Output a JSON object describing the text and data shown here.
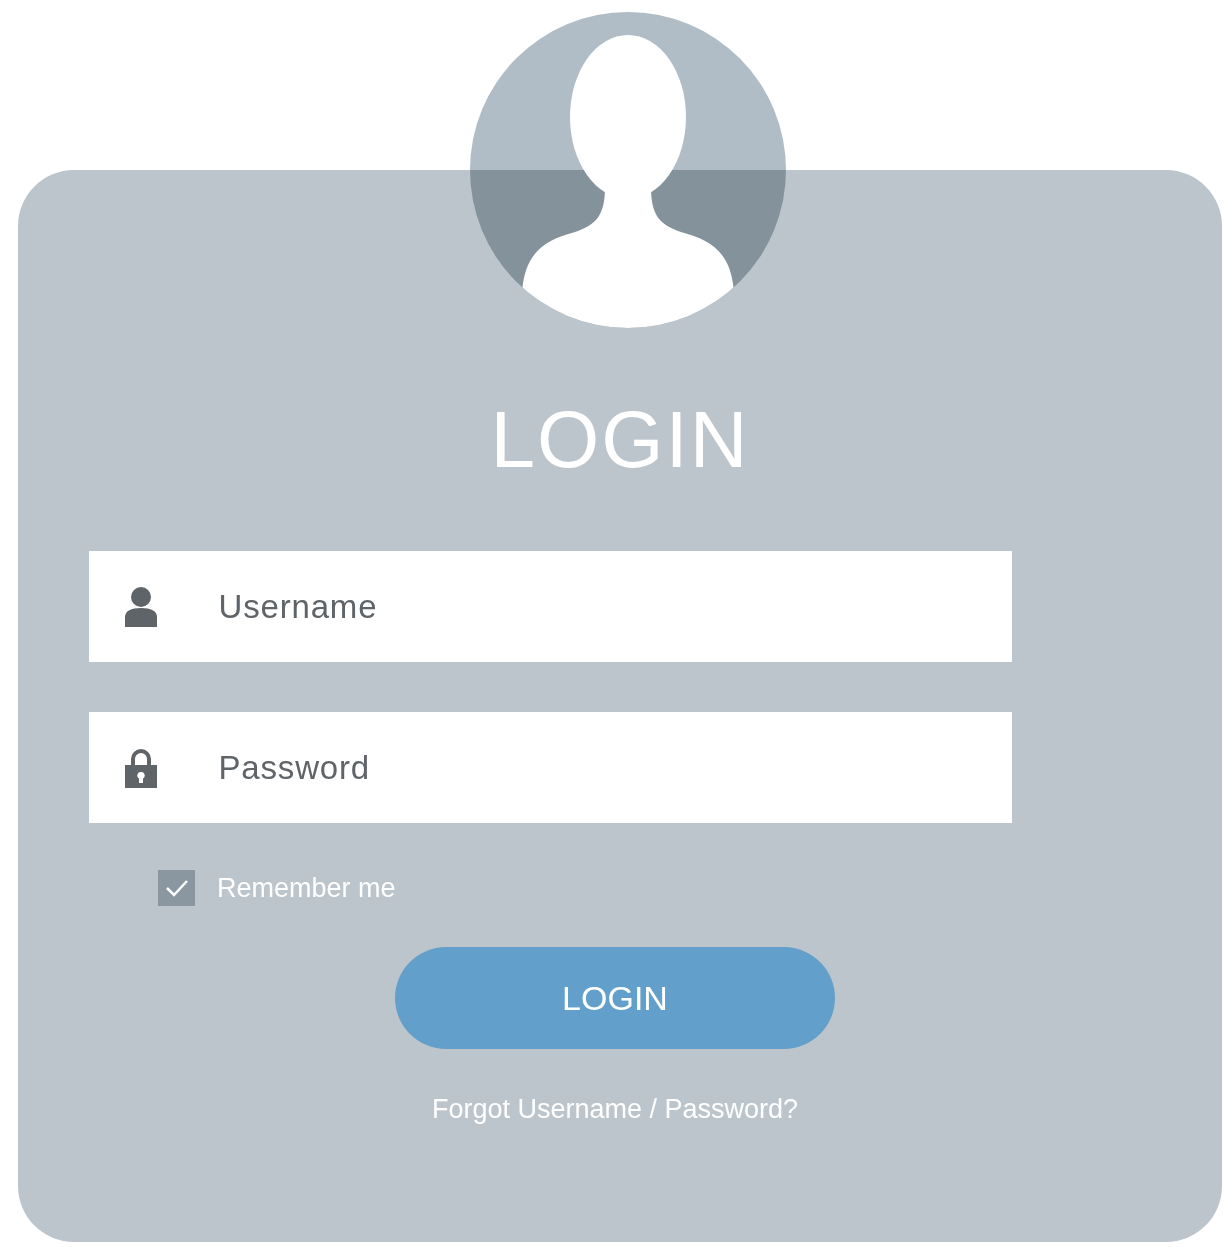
{
  "title": "LOGIN",
  "fields": [
    {
      "kind": "user",
      "placeholder": "Username"
    },
    {
      "kind": "lock",
      "placeholder": "Password"
    }
  ],
  "remember": {
    "label": "Remember me",
    "checked": true
  },
  "button": "LOGIN",
  "forgot_link": "Forgot Username / Password?"
}
